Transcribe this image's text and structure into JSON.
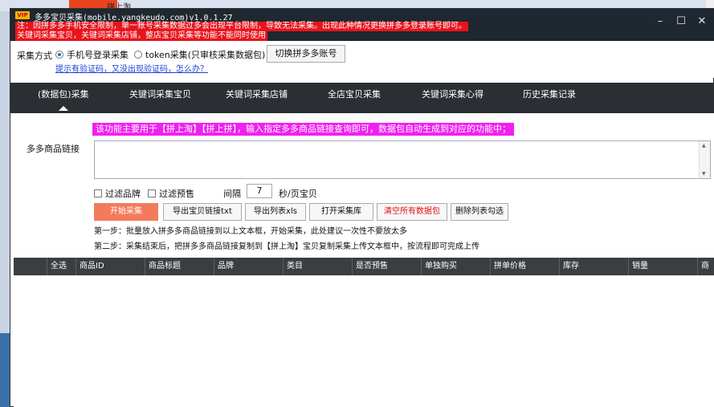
{
  "background": {
    "tab_text": "拼上淘"
  },
  "window": {
    "title": "多多宝贝采集(mobile.yangkeudo.com)v1.0.1.27",
    "vip_badge": "VIP",
    "warning_line1": "注：因拼多多手机安全限制，单一账号采集数据过多会出现平台限制，导致无法采集。出现此种情况更换拼多多登录账号即可。",
    "warning_line2": "关键词采集宝贝，关键词采集店铺，整店宝贝采集等功能不能同时使用",
    "minimize": "–",
    "maximize": "☐",
    "close": "✕"
  },
  "method": {
    "label": "采集方式",
    "option1": "手机号登录采集",
    "option2": "token采集(只审核采集数据包)",
    "switch_button": "切换拼多多账号",
    "captcha_link": "提示有验证码，又没出现验证码，怎么办？"
  },
  "tabs": [
    {
      "label": "(数据包)采集"
    },
    {
      "label": "关键词采集宝贝"
    },
    {
      "label": "关键词采集店铺"
    },
    {
      "label": "全店宝贝采集"
    },
    {
      "label": "关键词采集心得"
    },
    {
      "label": "历史采集记录"
    }
  ],
  "content": {
    "hint": "该功能主要用于【拼上淘】【拼上拼】，输入指定多多商品链接查询即可，数据包自动生成到对应的功能中；",
    "links_label": "多多商品链接",
    "links_value": "",
    "filter_brand": "过滤品牌",
    "filter_presale": "过滤预售",
    "interval_label": "间隔",
    "interval_value": "7",
    "interval_unit": "秒/页宝贝",
    "buttons": {
      "start": "开始采集",
      "export_links": "导出宝贝链接txt",
      "export_xls": "导出列表xls",
      "open_lib": "打开采集库",
      "clear_data": "清空所有数据包",
      "delete_selected": "删除列表勾选"
    },
    "step1": "第一步：批量放入拼多多商品链接到以上文本框，开始采集，此处建议一次性不要放太多",
    "step2": "第二步：采集结束后，把拼多多商品链接复制到【拼上淘】宝贝复制采集上传文本框中，按流程即可完成上传"
  },
  "table": {
    "columns": [
      "全选",
      "商品ID",
      "商品标题",
      "品牌",
      "类目",
      "是否预售",
      "单独购买",
      "拼单价格",
      "库存",
      "销量",
      "商"
    ]
  },
  "colors": {
    "titlebar": "#1f2730",
    "warning": "#e8141c",
    "hint": "#f020f0",
    "start_button": "#f47a5c",
    "tabbar": "#2b2e33",
    "table_header": "#3a3d42"
  }
}
